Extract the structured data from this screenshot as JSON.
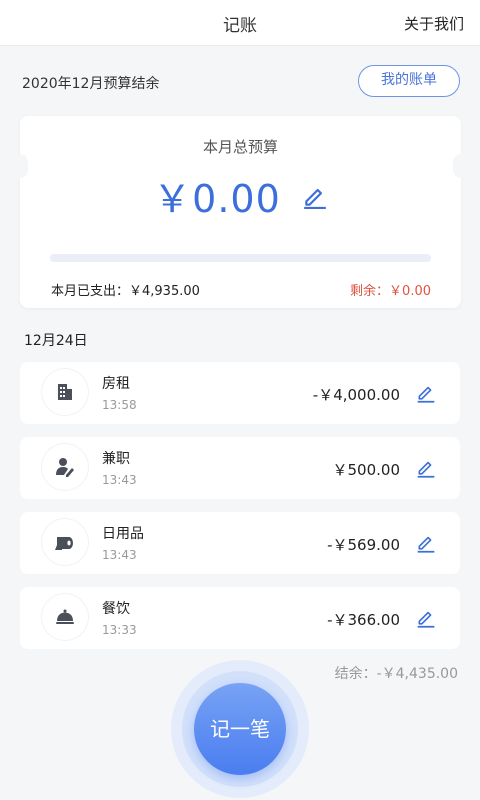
{
  "header": {
    "title": "记账",
    "about": "关于我们"
  },
  "budget": {
    "period_label": "2020年12月预算结余",
    "bill_button": "我的账单",
    "card_label": "本月总预算",
    "amount": "￥0.00",
    "spent_label": "本月已支出：￥4,935.00",
    "remain_label": "剩余：￥0.00",
    "progress_fraction": 0
  },
  "day": {
    "date": "12月24日",
    "records": [
      {
        "name": "房租",
        "time": "13:58",
        "amount": "-￥4,000.00",
        "icon": "building-icon"
      },
      {
        "name": "兼职",
        "time": "13:43",
        "amount": "￥500.00",
        "icon": "person-edit-icon"
      },
      {
        "name": "日用品",
        "time": "13:43",
        "amount": "-￥569.00",
        "icon": "tissue-roll-icon"
      },
      {
        "name": "餐饮",
        "time": "13:33",
        "amount": "-￥366.00",
        "icon": "food-cloche-icon"
      }
    ],
    "summary": "结余：-￥4,435.00"
  },
  "fab_label": "记一笔",
  "colors": {
    "accent": "#3c6fdb",
    "negative": "#e0533f",
    "icon": "#4a4f5a"
  }
}
